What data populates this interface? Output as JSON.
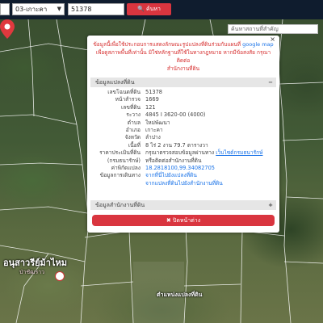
{
  "topbar": {
    "select_partial": "",
    "district_select": "03-เกาะคา",
    "parcel_input": "51378",
    "search_label": "ค้นหา",
    "place_search_placeholder": "ค้นหาสถานที่สำคัญ"
  },
  "popup": {
    "notice_line1": "ข้อมูลนี้เพื่อใช้ประกอบการแสดงลักษณะรูปแปลงที่ดินร่วมกับแผนที่",
    "notice_link": "google map",
    "notice_line2": "เพื่อดูสภาพพื้นที่เท่านั้น มิใช่หลักฐานที่ใช้ในทางกฎหมาย หากมีข้อสงสัย กรุณาติดต่อ",
    "notice_line3": "สำนักงานที่ดิน",
    "section1_title": "ข้อมูลแปลงที่ดิน",
    "section1_toggle": "−",
    "section2_title": "ข้อมูลสำนักงานที่ดิน",
    "section2_toggle": "+",
    "rows": [
      {
        "k": "เลขโฉนดที่ดิน",
        "v": "51378"
      },
      {
        "k": "หน้าสำรวจ",
        "v": "1669"
      },
      {
        "k": "เลขที่ดิน",
        "v": "121"
      },
      {
        "k": "ระวาง",
        "v": "4845 I 3620-00 (4000)"
      },
      {
        "k": "ตำบล",
        "v": "ใหม่พัฒนา"
      },
      {
        "k": "อำเภอ",
        "v": "เกาะคา"
      },
      {
        "k": "จังหวัด",
        "v": "ลำปาง"
      },
      {
        "k": "เนื้อที่",
        "v": "8 ไร่ 2 งาน 79.7 ตารางวา"
      },
      {
        "k": "ราคาประเมินที่ดิน",
        "v": "กรุณาตรวจสอบข้อมูลผ่านทาง",
        "link": "เว็บไซต์กรมธนารักษ์"
      },
      {
        "k": "(กรมธนารักษ์)",
        "v": "หรือติดต่อสำนักงานที่ดิน"
      },
      {
        "k": "ค่าพิกัดแปลง",
        "v": "18.2818100,99.34082705",
        "blue": true
      },
      {
        "k": "ข้อมูลการเดินทาง",
        "v": "จากที่นี่ไปยังแปลงที่ดิน",
        "blue": true
      },
      {
        "k": "",
        "v": "จากแปลงที่ดินไปยังสำนักงานที่ดิน",
        "blue": true
      }
    ],
    "close_label": "✖ ปิดหน้าต่าง"
  },
  "map": {
    "place_label": "อนุสาวรีย์ม้าไหม",
    "place_sublabel": "ป่าชัฒราว",
    "pin_label": "ตำแหน่งแปลงที่ดิน"
  },
  "colors": {
    "accent_red": "#d9353f",
    "topbar_bg": "#0f1c2e",
    "link_blue": "#1a73e8"
  }
}
